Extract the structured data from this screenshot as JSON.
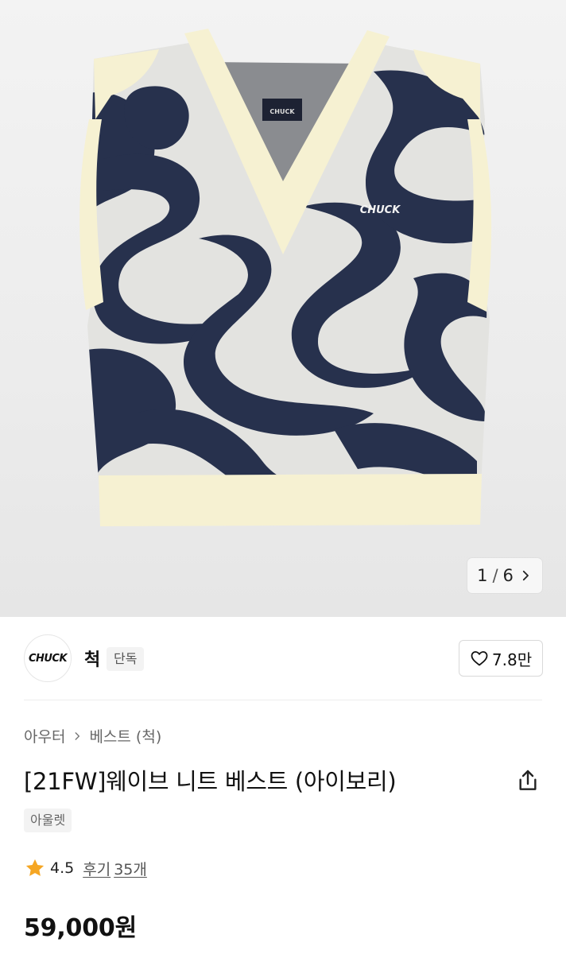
{
  "gallery": {
    "logo_text_neck": "CHUCK",
    "logo_text_chest": "CHUCK",
    "current": "1",
    "separator": "/",
    "total": "6"
  },
  "brand": {
    "logo_text": "CHUCK",
    "name": "척",
    "exclusive_badge": "단독"
  },
  "like": {
    "count": "7.8만"
  },
  "breadcrumb": {
    "category": "아우터",
    "subcategory": "베스트 (척)"
  },
  "product": {
    "title": "[21FW]웨이브 니트 베스트 (아이보리)",
    "tag": "아울렛",
    "rating": "4.5",
    "review_label": "후기",
    "review_count": "35개",
    "price": "59,000원"
  },
  "colors": {
    "navy": "#27314d",
    "ivory_trim": "#f6f1d2",
    "knit_grey": "#e3e3e0",
    "star": "#f5a623"
  },
  "icons": {
    "pager_next": "chevron-right-icon",
    "like": "heart-outline-icon",
    "breadcrumb_sep": "chevron-right-icon",
    "share": "share-icon",
    "rating": "star-icon"
  }
}
